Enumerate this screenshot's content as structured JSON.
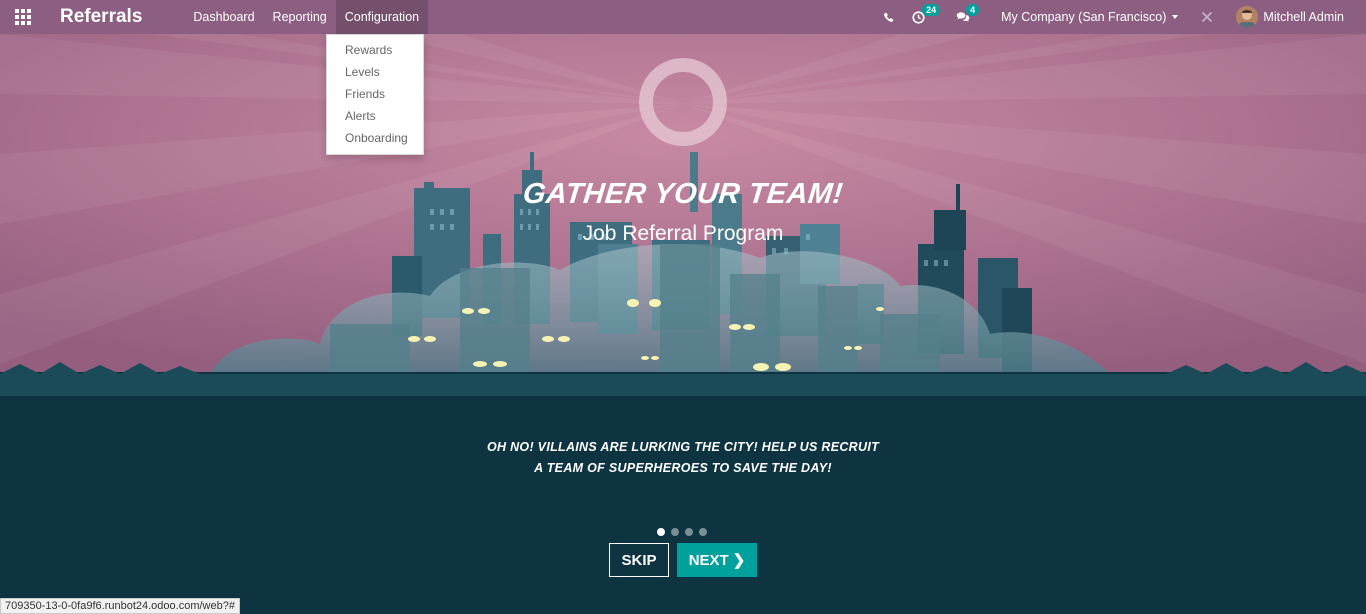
{
  "app": {
    "title": "Referrals"
  },
  "nav": {
    "items": [
      {
        "label": "Dashboard"
      },
      {
        "label": "Reporting"
      },
      {
        "label": "Configuration"
      }
    ]
  },
  "configuration_menu": {
    "items": [
      {
        "label": "Rewards"
      },
      {
        "label": "Levels"
      },
      {
        "label": "Friends"
      },
      {
        "label": "Alerts"
      },
      {
        "label": "Onboarding"
      }
    ]
  },
  "systray": {
    "activities_count": "24",
    "messages_count": "4",
    "company": "My Company (San Francisco)",
    "user": "Mitchell Admin"
  },
  "hero": {
    "title": "GATHER YOUR TEAM!",
    "subtitle": "Job Referral Program",
    "story_line1": "OH NO! VILLAINS ARE LURKING THE CITY! HELP US RECRUIT",
    "story_line2": "A TEAM OF SUPERHEROES TO SAVE THE DAY!",
    "pages_total": 4,
    "current_page": 1
  },
  "buttons": {
    "skip": "SKIP",
    "next": "NEXT"
  },
  "statusbar": {
    "url": "709350-13-0-0fa9f6.runbot24.odoo.com/web?#"
  },
  "colors": {
    "navbar": "#8b5e82",
    "sky": "#b36f8c",
    "ground": "#0e3442",
    "accent": "#00a09d"
  }
}
